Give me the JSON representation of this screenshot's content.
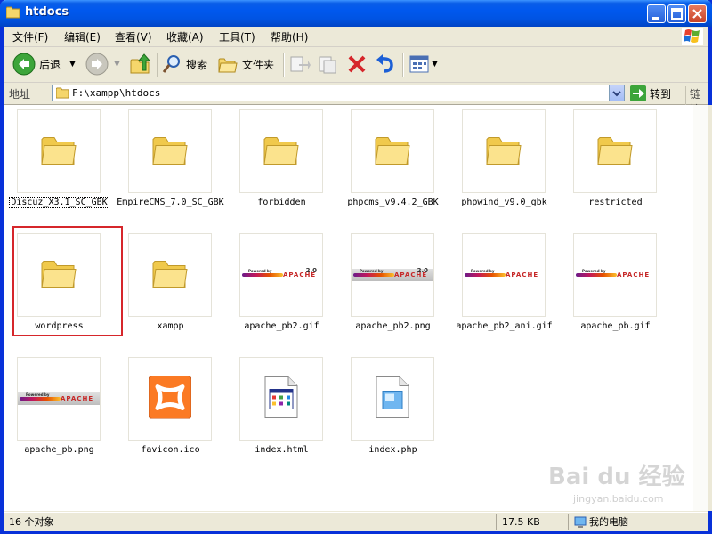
{
  "window": {
    "title": "htdocs"
  },
  "menu": [
    "文件(F)",
    "编辑(E)",
    "查看(V)",
    "收藏(A)",
    "工具(T)",
    "帮助(H)"
  ],
  "toolbar": {
    "back_label": "后退",
    "search_label": "搜索",
    "folders_label": "文件夹"
  },
  "address": {
    "label": "地址",
    "value": "F:\\xampp\\htdocs",
    "go_label": "转到",
    "links_label": "链接"
  },
  "items": [
    {
      "name": "Discuz_X3.1_SC_GBK",
      "icon": "folder-icon"
    },
    {
      "name": "EmpireCMS_7.0_SC_GBK",
      "icon": "folder-icon"
    },
    {
      "name": "forbidden",
      "icon": "folder-icon"
    },
    {
      "name": "phpcms_v9.4.2_GBK",
      "icon": "folder-icon"
    },
    {
      "name": "phpwind_v9.0_gbk",
      "icon": "folder-icon"
    },
    {
      "name": "restricted",
      "icon": "folder-icon"
    },
    {
      "name": "wordpress",
      "icon": "folder-icon"
    },
    {
      "name": "xampp",
      "icon": "folder-icon"
    },
    {
      "name": "apache_pb2.gif",
      "icon": "apache-logo-thumbnail"
    },
    {
      "name": "apache_pb2.png",
      "icon": "apache-logo-thumbnail"
    },
    {
      "name": "apache_pb2_ani.gif",
      "icon": "apache-logo-thumbnail"
    },
    {
      "name": "apache_pb.gif",
      "icon": "apache-logo-thumbnail"
    },
    {
      "name": "apache_pb.png",
      "icon": "apache-logo-thumbnail"
    },
    {
      "name": "favicon.ico",
      "icon": "xampp-icon"
    },
    {
      "name": "index.html",
      "icon": "html-file-icon"
    },
    {
      "name": "index.php",
      "icon": "php-file-icon"
    }
  ],
  "apache_logo": {
    "powered_by": "Powered by",
    "word": "APACHE",
    "version": "2.0"
  },
  "status": {
    "count": "16 个对象",
    "size": "17.5 KB",
    "zone": "我的电脑"
  },
  "watermark": {
    "brand": "Bai du 经验",
    "url": "jingyan.baidu.com"
  }
}
